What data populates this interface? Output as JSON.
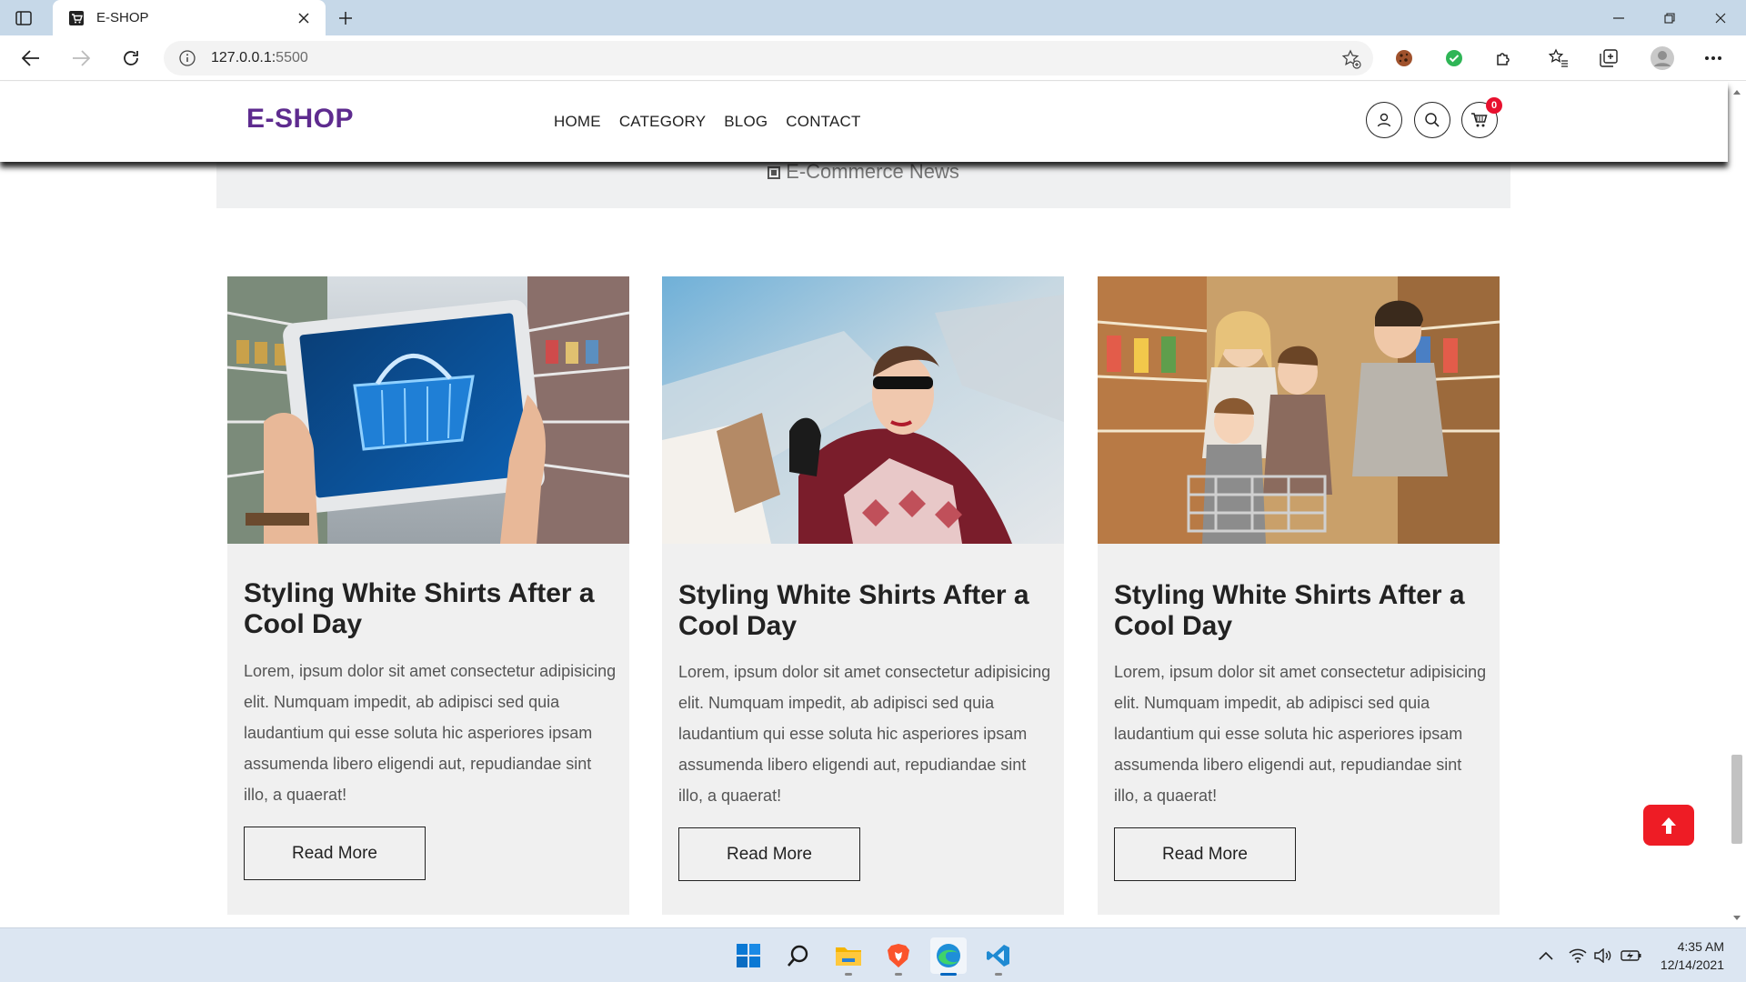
{
  "browser": {
    "tab_title": "E-SHOP",
    "url_host": "127.0.0.1:",
    "url_port": "5500"
  },
  "site": {
    "logo": "E-SHOP",
    "nav": [
      {
        "label": "HOME"
      },
      {
        "label": "CATEGORY"
      },
      {
        "label": "BLOG"
      },
      {
        "label": "CONTACT"
      }
    ],
    "cart_count": "0",
    "banner": "E-Commerce News"
  },
  "cards": [
    {
      "image": "shopping-basket-tablet-image",
      "title": "Styling White Shirts After a Cool Day",
      "text": "Lorem, ipsum dolor sit amet consectetur adipisicing elit. Numquam impedit, ab adipisci sed quia laudantium qui esse soluta hic asperiores ipsam assumenda libero eligendi aut, repudiandae sint illo, a quaerat!",
      "button": "Read More"
    },
    {
      "image": "woman-shopping-bags-image",
      "title": "Styling White Shirts After a Cool Day",
      "text": "Lorem, ipsum dolor sit amet consectetur adipisicing elit. Numquam impedit, ab adipisci sed quia laudantium qui esse soluta hic asperiores ipsam assumenda libero eligendi aut, repudiandae sint illo, a quaerat!",
      "button": "Read More"
    },
    {
      "image": "family-supermarket-image",
      "title": "Styling White Shirts After a Cool Day",
      "text": "Lorem, ipsum dolor sit amet consectetur adipisicing elit. Numquam impedit, ab adipisci sed quia laudantium qui esse soluta hic asperiores ipsam assumenda libero eligendi aut, repudiandae sint illo, a quaerat!",
      "button": "Read More"
    }
  ],
  "taskbar": {
    "time": "4:35 AM",
    "date": "12/14/2021"
  },
  "colors": {
    "brand": "#5e2b8f",
    "accent_red": "#ee1c25",
    "card_bg": "#f0f0f0"
  }
}
